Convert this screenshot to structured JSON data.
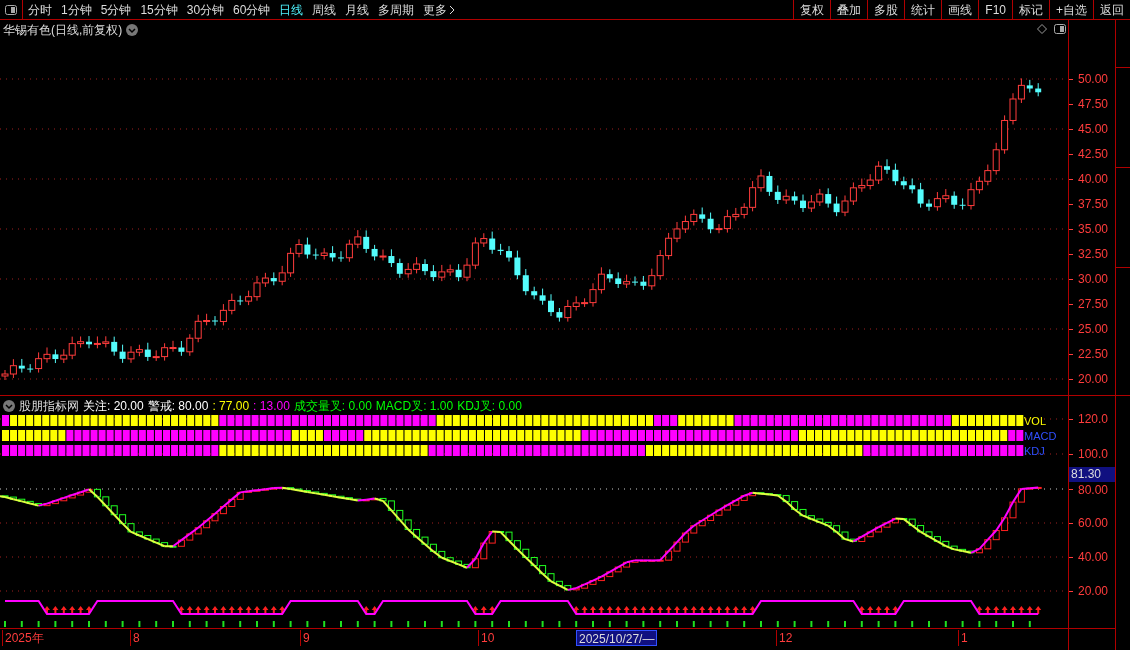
{
  "toolbar": {
    "periods": [
      {
        "label": "分时",
        "selected": false
      },
      {
        "label": "1分钟",
        "selected": false
      },
      {
        "label": "5分钟",
        "selected": false
      },
      {
        "label": "15分钟",
        "selected": false
      },
      {
        "label": "30分钟",
        "selected": false
      },
      {
        "label": "60分钟",
        "selected": false
      },
      {
        "label": "日线",
        "selected": true
      },
      {
        "label": "周线",
        "selected": false
      },
      {
        "label": "月线",
        "selected": false
      },
      {
        "label": "多周期",
        "selected": false
      }
    ],
    "more": "更多",
    "buttons": [
      "复权",
      "叠加",
      "多股",
      "统计",
      "画线",
      "F10",
      "标记",
      "+自选",
      "返回"
    ]
  },
  "price_panel": {
    "title": "华锡有色(日线,前复权)",
    "y_ticks": [
      "50.00",
      "47.50",
      "45.00",
      "42.50",
      "40.00",
      "37.50",
      "35.00",
      "32.50",
      "30.00",
      "27.50",
      "25.00",
      "22.50",
      "20.00"
    ]
  },
  "indicator": {
    "title": "股朋指标网",
    "values": [
      {
        "text": "关注: 20.00",
        "kind": "threshold"
      },
      {
        "text": "警戒: 80.00",
        "kind": "threshold"
      },
      {
        "text": ": 77.00",
        "kind": "line_a"
      },
      {
        "text": ": 13.00",
        "kind": "line_b"
      },
      {
        "text": "成交量叉: 0.00",
        "kind": "cross"
      },
      {
        "text": "MACD叉: 1.00",
        "kind": "cross"
      },
      {
        "text": "KDJ叉: 0.00",
        "kind": "cross"
      }
    ],
    "row_labels": [
      "VOL",
      "MACD",
      "KDJ"
    ],
    "y_ticks": [
      "120.0",
      "100.0",
      "80.00",
      "60.00",
      "40.00",
      "20.00"
    ],
    "current_value": "81.30"
  },
  "date_axis": {
    "labels": [
      {
        "text": "2025年",
        "selected": false
      },
      {
        "text": "8",
        "selected": false
      },
      {
        "text": "9",
        "selected": false
      },
      {
        "text": "10",
        "selected": false
      },
      {
        "text": "2025/10/27/—",
        "selected": true
      },
      {
        "text": "12",
        "selected": false
      },
      {
        "text": "1",
        "selected": false
      }
    ]
  }
}
